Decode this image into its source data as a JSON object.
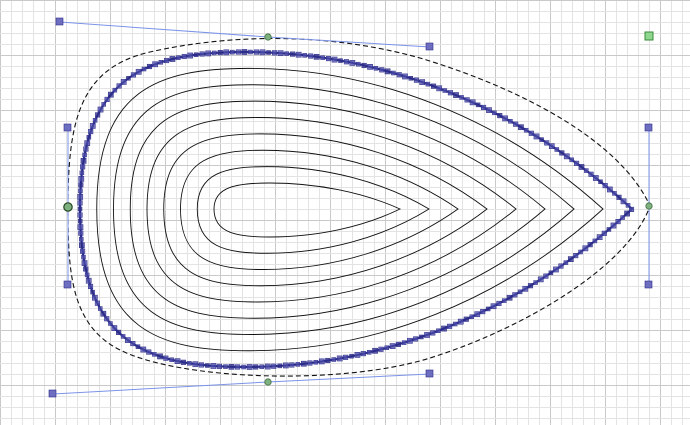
{
  "canvas": {
    "background": "#ffffff",
    "grid_minor_color": "#e3e3e3",
    "grid_major_color": "#c9c9c9"
  },
  "colors": {
    "contour": "#111111",
    "dashed_outline": "#111111",
    "handle_line": "#7c93e8",
    "handle_node": "#6e6ec0",
    "path_node": "#4a4aa8",
    "path_node_dark": "#2c2c8a",
    "anchor_node": "#7fb07f",
    "corner_node": "#8fd68f"
  },
  "icons": {
    "selected_anchor": "circle-node-icon",
    "handle": "square-handle-icon",
    "corner_marker": "green-square-icon"
  },
  "shape": {
    "contour_count": 9,
    "outline_style": "dashed"
  }
}
